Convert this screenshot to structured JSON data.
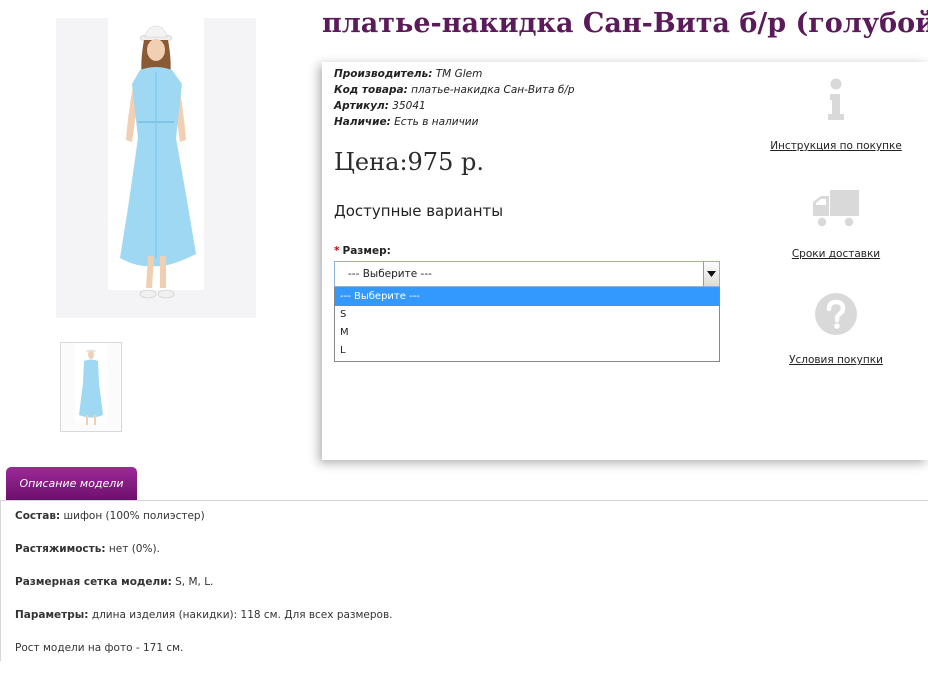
{
  "product": {
    "title": "платье-накидка Сан-Вита б/р (голубой)",
    "meta": [
      {
        "key": "Производитель:",
        "value": "TM Glem"
      },
      {
        "key": "Код товара:",
        "value": "платье-накидка Сан-Вита б/р"
      },
      {
        "key": "Артикул:",
        "value": "35041"
      },
      {
        "key": "Наличие:",
        "value": "Есть в наличии"
      }
    ],
    "price": "Цена:975 р.",
    "variants_title": "Доступные варианты",
    "size": {
      "required_mark": "*",
      "label": "Размер:",
      "selected": "--- Выберите ---",
      "options": [
        "--- Выберите ---",
        "S",
        "M",
        "L"
      ]
    }
  },
  "side_links": [
    {
      "label": "Инструкция по покупке",
      "icon": "info-icon"
    },
    {
      "label": "Сроки доставки",
      "icon": "truck-icon"
    },
    {
      "label": "Условия покупки",
      "icon": "question-icon"
    }
  ],
  "tabs": [
    {
      "label": "Описание модели"
    }
  ],
  "description": [
    {
      "key": "Состав:",
      "value": " шифон (100% полиэстер)"
    },
    {
      "key": "Растяжимость:",
      "value": " нет (0%)."
    },
    {
      "key": "Размерная сетка модели:",
      "value": " S, M, L."
    },
    {
      "key": "Параметры:",
      "value": " длина изделия (накидки): 118 см. Для всех размеров."
    },
    {
      "key": "",
      "value": "Рост модели на фото - 171 см."
    }
  ],
  "colors": {
    "title": "#5b1a5a",
    "tab_bg": "#8a1f88",
    "selected_option": "#3399ff",
    "dress": "#9fd8f3",
    "icon_gray": "#d9d9d9"
  }
}
